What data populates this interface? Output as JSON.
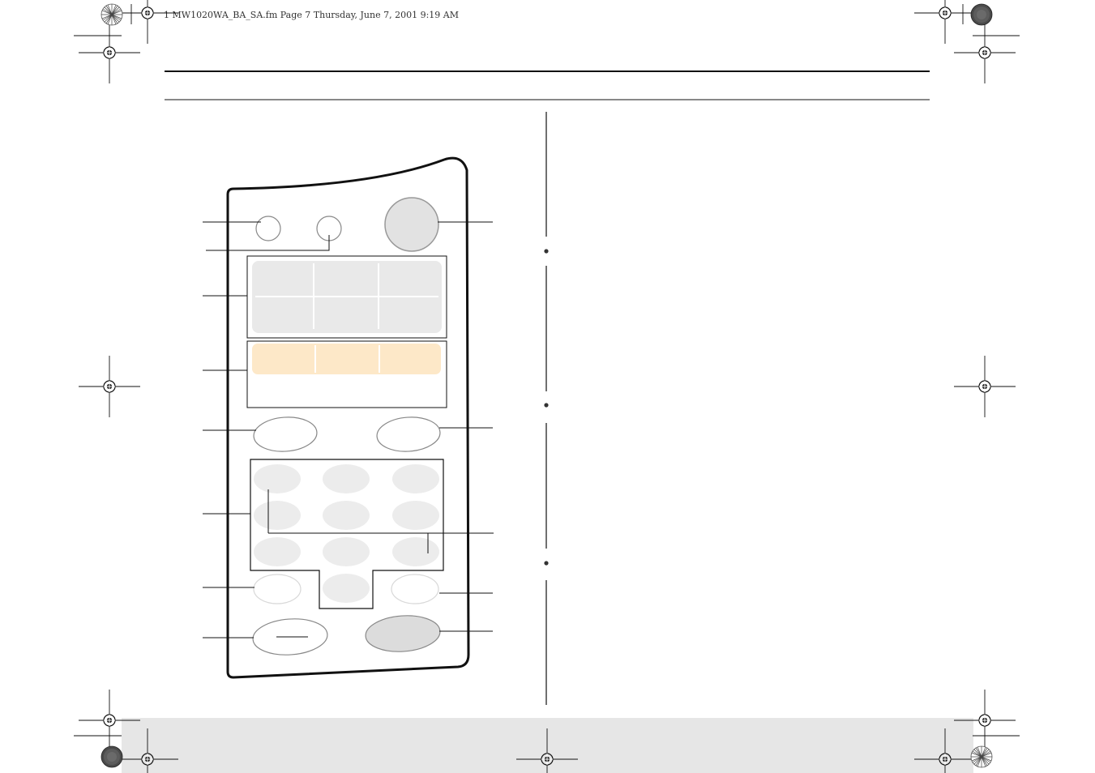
{
  "header": {
    "print_info": "1 MW1020WA_BA_SA.fm  Page 7  Thursday, June 7, 2001  9:19 AM"
  },
  "colors": {
    "footer_band": "#e6e6e6",
    "display_gray": "#e9e9e9",
    "preset_peach": "#fde8c8",
    "key_gray": "#ececec",
    "dial_gray": "#e2e2e2",
    "outline": "#111111"
  },
  "icons": {
    "registration_mark": "crosshair-circle",
    "color_bar_disc": "hatched-disc",
    "starburst_disc": "starburst-disc"
  }
}
